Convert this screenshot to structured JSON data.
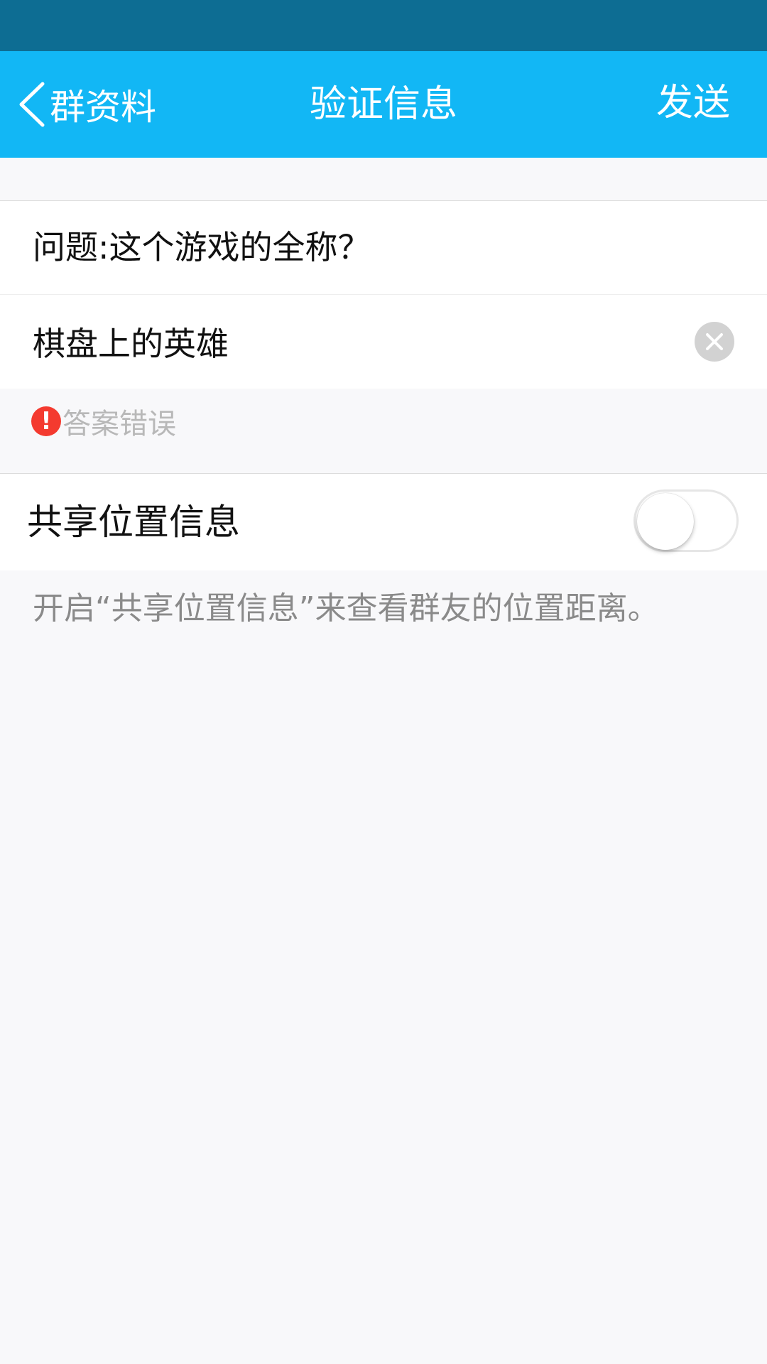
{
  "colors": {
    "status_bar": "#0d6d93",
    "nav_bar": "#12b7f5",
    "error": "#f43a2f",
    "background": "#f8f8fa"
  },
  "nav": {
    "back_label": "群资料",
    "title": "验证信息",
    "send_label": "发送",
    "back_icon": "chevron-left-icon"
  },
  "form": {
    "question": "问题:这个游戏的全称？",
    "answer_value": "棋盘上的英雄",
    "clear_icon": "clear-icon",
    "error_icon": "exclamation-icon",
    "error_text": "答案错误"
  },
  "location": {
    "label": "共享位置信息",
    "enabled": false,
    "hint": "开启“共享位置信息”来查看群友的位置距离。"
  }
}
